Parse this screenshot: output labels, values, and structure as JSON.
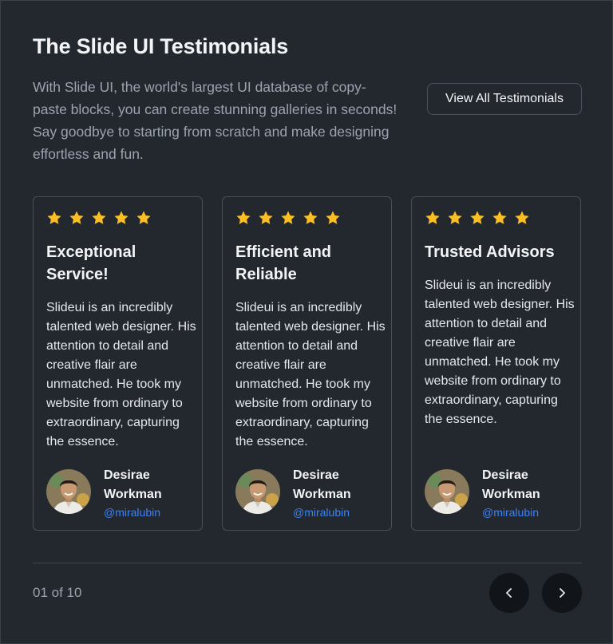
{
  "header": {
    "title": "The Slide UI Testimonials",
    "description": "With Slide UI, the world's largest UI database of copy-paste blocks, you can create stunning galleries in seconds! Say goodbye to starting from scratch and make designing effortless and fun.",
    "view_all_label": "View All Testimonials"
  },
  "testimonials": [
    {
      "rating": 5,
      "title": "Exceptional Service!",
      "body": "Slideui is an incredibly talented web designer. His attention to detail and creative flair are unmatched. He took my website from ordinary to extraordinary, capturing the essence.",
      "author_name": "Desirae Workman",
      "author_handle": "@miralubin"
    },
    {
      "rating": 5,
      "title": "Efficient and Reliable",
      "body": "Slideui is an incredibly talented web designer. His attention to detail and creative flair are unmatched. He took my website from ordinary to extraordinary, capturing the essence.",
      "author_name": "Desirae Workman",
      "author_handle": "@miralubin"
    },
    {
      "rating": 5,
      "title": "Trusted Advisors",
      "body": "Slideui is an incredibly talented web designer. His attention to detail and creative flair are unmatched. He took my website from ordinary to extraordinary, capturing the essence.",
      "author_name": "Desirae Workman",
      "author_handle": "@miralubin"
    }
  ],
  "pagination": {
    "label": "01 of 10",
    "prev_icon": "chevron-left-icon",
    "next_icon": "chevron-right-icon"
  },
  "colors": {
    "background": "#23282f",
    "star": "#fbbf24",
    "handle": "#3b82f6",
    "nav_button": "#111419"
  }
}
